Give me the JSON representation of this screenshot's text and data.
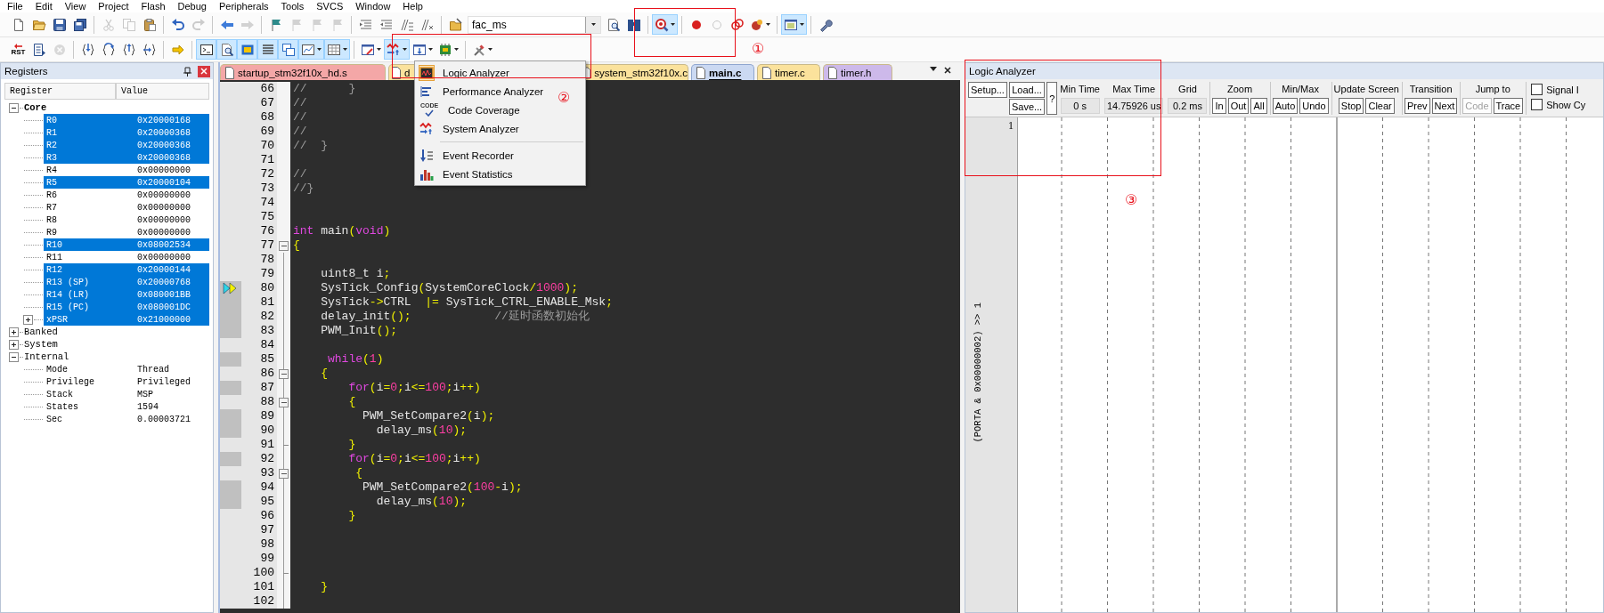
{
  "menu_bar": [
    "File",
    "Edit",
    "View",
    "Project",
    "Flash",
    "Debug",
    "Peripherals",
    "Tools",
    "SVCS",
    "Window",
    "Help"
  ],
  "toolbar_top": [
    {
      "kind": "new",
      "on": false,
      "disabled": false
    },
    {
      "kind": "open",
      "on": false,
      "disabled": false
    },
    {
      "kind": "save",
      "on": false,
      "disabled": false
    },
    {
      "kind": "saveall",
      "on": false,
      "disabled": false
    },
    {
      "kind": "separator"
    },
    {
      "kind": "cut",
      "on": false,
      "disabled": true
    },
    {
      "kind": "copy",
      "on": false,
      "disabled": true
    },
    {
      "kind": "paste",
      "on": false,
      "disabled": false
    },
    {
      "kind": "separator"
    },
    {
      "kind": "undo",
      "on": false,
      "disabled": false
    },
    {
      "kind": "redo",
      "on": false,
      "disabled": true
    },
    {
      "kind": "separator"
    },
    {
      "kind": "back",
      "on": false,
      "disabled": false
    },
    {
      "kind": "forward",
      "on": false,
      "disabled": true
    },
    {
      "kind": "separator"
    },
    {
      "kind": "bookmark",
      "on": false,
      "disabled": false
    },
    {
      "kind": "bookmarkprev",
      "on": false,
      "disabled": true
    },
    {
      "kind": "bookmarknext",
      "on": false,
      "disabled": true
    },
    {
      "kind": "bookmarkclear",
      "on": false,
      "disabled": true
    },
    {
      "kind": "separator"
    },
    {
      "kind": "indent",
      "on": false,
      "disabled": false
    },
    {
      "kind": "unindent",
      "on": false,
      "disabled": false
    },
    {
      "kind": "comment",
      "on": false,
      "disabled": false
    },
    {
      "kind": "uncomment",
      "on": false,
      "disabled": false
    },
    {
      "kind": "separator"
    },
    {
      "kind": "openfolder",
      "on": false,
      "disabled": false
    },
    {
      "kind": "search",
      "value": "fac_ms"
    },
    {
      "kind": "findfiles",
      "on": false,
      "disabled": false
    },
    {
      "kind": "incremental",
      "on": false,
      "disabled": false
    },
    {
      "kind": "separator"
    },
    {
      "kind": "debug",
      "on": true,
      "disabled": false,
      "caret": true
    },
    {
      "kind": "separator"
    },
    {
      "kind": "breakpoint",
      "on": false,
      "disabled": false
    },
    {
      "kind": "breakpointoff",
      "on": false,
      "disabled": false
    },
    {
      "kind": "disable",
      "on": false,
      "disabled": false
    },
    {
      "kind": "killall",
      "on": false,
      "disabled": false,
      "caret": true
    },
    {
      "kind": "separator"
    },
    {
      "kind": "window",
      "on": true,
      "disabled": false,
      "caret": true
    },
    {
      "kind": "separator"
    },
    {
      "kind": "configure",
      "on": false,
      "disabled": false
    }
  ],
  "toolbar_debug": [
    {
      "kind": "reset",
      "text": "RST",
      "on": false,
      "disabled": false
    },
    {
      "kind": "run",
      "on": false,
      "disabled": false
    },
    {
      "kind": "stop",
      "on": false,
      "disabled": true
    },
    {
      "kind": "separator"
    },
    {
      "kind": "stepin",
      "on": false,
      "disabled": false
    },
    {
      "kind": "stepover",
      "on": false,
      "disabled": false
    },
    {
      "kind": "stepout",
      "on": false,
      "disabled": false
    },
    {
      "kind": "runcursor",
      "on": false,
      "disabled": false
    },
    {
      "kind": "separator"
    },
    {
      "kind": "showpc",
      "on": false,
      "disabled": false
    },
    {
      "kind": "separator"
    },
    {
      "kind": "command",
      "on": true,
      "disabled": false
    },
    {
      "kind": "disassembly",
      "on": true,
      "disabled": false
    },
    {
      "kind": "symbols",
      "on": true,
      "disabled": false
    },
    {
      "kind": "registers",
      "on": true,
      "disabled": false
    },
    {
      "kind": "callstack",
      "on": true,
      "disabled": false
    },
    {
      "kind": "watch",
      "on": true,
      "disabled": false,
      "caret": true
    },
    {
      "kind": "memory",
      "on": true,
      "disabled": false,
      "caret": true
    },
    {
      "kind": "separator"
    },
    {
      "kind": "serial",
      "on": false,
      "disabled": false,
      "caret": true
    },
    {
      "kind": "analysis",
      "on": true,
      "disabled": false,
      "caret": true
    },
    {
      "kind": "trace",
      "on": false,
      "disabled": false,
      "caret": true
    },
    {
      "kind": "peripherals",
      "on": false,
      "disabled": false,
      "caret": true
    },
    {
      "kind": "separator"
    },
    {
      "kind": "toolbox",
      "on": false,
      "disabled": false,
      "caret": true
    }
  ],
  "analysis_menu": {
    "groups": [
      [
        {
          "label": "Logic Analyzer",
          "kind": "logic",
          "selected": true
        },
        {
          "label": "Performance Analyzer",
          "kind": "performance",
          "selected": false
        },
        {
          "label": "Code Coverage",
          "kind": "coverage",
          "icon_text": "CODE",
          "selected": false
        },
        {
          "label": "System Analyzer",
          "kind": "system",
          "selected": false
        }
      ],
      [
        {
          "label": "Event Recorder",
          "kind": "recorder",
          "selected": false
        },
        {
          "label": "Event Statistics",
          "kind": "statistics",
          "selected": false
        }
      ]
    ]
  },
  "registers": {
    "title": "Registers",
    "columns": [
      "Register",
      "Value"
    ],
    "tree": [
      {
        "name": "Core",
        "expanded": true,
        "emphasized": true,
        "children": [
          {
            "name": "R0",
            "value": "0x20000168",
            "selected": true
          },
          {
            "name": "R1",
            "value": "0x20000368",
            "selected": true
          },
          {
            "name": "R2",
            "value": "0x20000368",
            "selected": true
          },
          {
            "name": "R3",
            "value": "0x20000368",
            "selected": true
          },
          {
            "name": "R4",
            "value": "0x00000000",
            "selected": false
          },
          {
            "name": "R5",
            "value": "0x20000104",
            "selected": true
          },
          {
            "name": "R6",
            "value": "0x00000000",
            "selected": false
          },
          {
            "name": "R7",
            "value": "0x00000000",
            "selected": false
          },
          {
            "name": "R8",
            "value": "0x00000000",
            "selected": false
          },
          {
            "name": "R9",
            "value": "0x00000000",
            "selected": false
          },
          {
            "name": "R10",
            "value": "0x08002534",
            "selected": true
          },
          {
            "name": "R11",
            "value": "0x00000000",
            "selected": false
          },
          {
            "name": "R12",
            "value": "0x20000144",
            "selected": true
          },
          {
            "name": "R13 (SP)",
            "value": "0x20000768",
            "selected": true
          },
          {
            "name": "R14 (LR)",
            "value": "0x080001BB",
            "selected": true
          },
          {
            "name": "R15 (PC)",
            "value": "0x080001DC",
            "selected": true
          },
          {
            "name": "xPSR",
            "value": "0x21000000",
            "selected": true,
            "expanded": false
          }
        ]
      },
      {
        "name": "Banked",
        "expanded": false,
        "emphasized": false
      },
      {
        "name": "System",
        "expanded": false,
        "emphasized": false
      },
      {
        "name": "Internal",
        "expanded": true,
        "emphasized": false,
        "children": [
          {
            "name": "Mode",
            "value": "Thread",
            "selected": false
          },
          {
            "name": "Privilege",
            "value": "Privileged",
            "selected": false
          },
          {
            "name": "Stack",
            "value": "MSP",
            "selected": false
          },
          {
            "name": "States",
            "value": "1594",
            "selected": false
          },
          {
            "name": "Sec",
            "value": "0.00003721",
            "selected": false
          }
        ]
      }
    ]
  },
  "editor": {
    "tabs": [
      {
        "label": "startup_stm32f10x_hd.s",
        "color": "#f4a7a7",
        "selected": false
      },
      {
        "label": "d",
        "color": "#fbe29c",
        "selected": false
      },
      {
        "label": "system_stm32f10x.c",
        "color": "#fbe29c",
        "selected": false
      },
      {
        "label": "main.c",
        "color": "#cbd9f2",
        "selected": true
      },
      {
        "label": "timer.c",
        "color": "#fbe29c",
        "selected": false
      },
      {
        "label": "timer.h",
        "color": "#cdb9ea",
        "selected": false
      }
    ],
    "lines": [
      {
        "number": "66",
        "executable": false,
        "current": false,
        "fold_start": false,
        "fold_end": false,
        "segments": [
          {
            "kind": "comment",
            "text": "//      }"
          }
        ]
      },
      {
        "number": "67",
        "executable": false,
        "current": false,
        "fold_start": false,
        "fold_end": false,
        "segments": [
          {
            "kind": "comment",
            "text": "//"
          }
        ]
      },
      {
        "number": "68",
        "executable": false,
        "current": false,
        "fold_start": false,
        "fold_end": false,
        "segments": [
          {
            "kind": "comment",
            "text": "//"
          }
        ]
      },
      {
        "number": "69",
        "executable": false,
        "current": false,
        "fold_start": false,
        "fold_end": false,
        "segments": [
          {
            "kind": "comment",
            "text": "//"
          }
        ]
      },
      {
        "number": "70",
        "executable": false,
        "current": false,
        "fold_start": false,
        "fold_end": false,
        "segments": [
          {
            "kind": "comment",
            "text": "//  }"
          }
        ]
      },
      {
        "number": "71",
        "executable": false,
        "current": false,
        "fold_start": false,
        "fold_end": false
      },
      {
        "number": "72",
        "executable": false,
        "current": false,
        "fold_start": false,
        "fold_end": false,
        "segments": [
          {
            "kind": "comment",
            "text": "//"
          }
        ]
      },
      {
        "number": "73",
        "executable": false,
        "current": false,
        "fold_start": false,
        "fold_end": false,
        "segments": [
          {
            "kind": "comment",
            "text": "//}"
          }
        ]
      },
      {
        "number": "74",
        "executable": false,
        "current": false,
        "fold_start": false,
        "fold_end": false
      },
      {
        "number": "75",
        "executable": false,
        "current": false,
        "fold_start": false,
        "fold_end": false
      },
      {
        "number": "76",
        "executable": false,
        "current": false,
        "fold_start": false,
        "fold_end": false,
        "segments": [
          {
            "kind": "keyword",
            "text": "int"
          },
          {
            "kind": "code",
            "text": " main("
          },
          {
            "kind": "keyword",
            "text": "void"
          },
          {
            "kind": "code",
            "text": ")"
          }
        ]
      },
      {
        "number": "77",
        "executable": false,
        "current": false,
        "fold_start": true,
        "fold_end": false,
        "segments": [
          {
            "kind": "code",
            "text": "{"
          }
        ]
      },
      {
        "number": "78",
        "executable": false,
        "current": false,
        "fold_start": false,
        "fold_end": false
      },
      {
        "number": "79",
        "executable": false,
        "current": false,
        "fold_start": false,
        "fold_end": false,
        "segments": [
          {
            "kind": "code",
            "text": "    uint8_t i;"
          }
        ]
      },
      {
        "number": "80",
        "executable": true,
        "current": true,
        "fold_start": false,
        "fold_end": false,
        "segments": [
          {
            "kind": "code",
            "text": "    SysTick_Config(SystemCoreClock/1000);"
          }
        ]
      },
      {
        "number": "81",
        "executable": true,
        "current": false,
        "fold_start": false,
        "fold_end": false,
        "segments": [
          {
            "kind": "code",
            "text": "    SysTick->CTRL  |= SysTick_CTRL_ENABLE_Msk;"
          }
        ]
      },
      {
        "number": "82",
        "executable": true,
        "current": false,
        "fold_start": false,
        "fold_end": false,
        "segments": [
          {
            "kind": "code",
            "text": "    delay_init();            "
          },
          {
            "kind": "comment",
            "text": "//延时函数初始化"
          }
        ]
      },
      {
        "number": "83",
        "executable": true,
        "current": false,
        "fold_start": false,
        "fold_end": false,
        "segments": [
          {
            "kind": "code",
            "text": "    PWM_Init();"
          }
        ]
      },
      {
        "number": "84",
        "executable": false,
        "current": false,
        "fold_start": false,
        "fold_end": false
      },
      {
        "number": "85",
        "executable": true,
        "current": false,
        "fold_start": false,
        "fold_end": false,
        "segments": [
          {
            "kind": "keyword",
            "text": "     while"
          },
          {
            "kind": "code",
            "text": "(1)"
          }
        ]
      },
      {
        "number": "86",
        "executable": false,
        "current": false,
        "fold_start": true,
        "fold_end": false,
        "segments": [
          {
            "kind": "code",
            "text": "    {"
          }
        ]
      },
      {
        "number": "87",
        "executable": true,
        "current": false,
        "fold_start": false,
        "fold_end": false,
        "segments": [
          {
            "kind": "keyword",
            "text": "        for"
          },
          {
            "kind": "code",
            "text": "(i=0;i<=100;i++)"
          }
        ]
      },
      {
        "number": "88",
        "executable": false,
        "current": false,
        "fold_start": true,
        "fold_end": false,
        "segments": [
          {
            "kind": "code",
            "text": "        {"
          }
        ]
      },
      {
        "number": "89",
        "executable": true,
        "current": false,
        "fold_start": false,
        "fold_end": false,
        "segments": [
          {
            "kind": "code",
            "text": "          PWM_SetCompare2(i);"
          }
        ]
      },
      {
        "number": "90",
        "executable": true,
        "current": false,
        "fold_start": false,
        "fold_end": false,
        "segments": [
          {
            "kind": "code",
            "text": "            delay_ms(10);"
          }
        ]
      },
      {
        "number": "91",
        "executable": false,
        "current": false,
        "fold_start": false,
        "fold_end": true,
        "segments": [
          {
            "kind": "code",
            "text": "        }"
          }
        ]
      },
      {
        "number": "92",
        "executable": true,
        "current": false,
        "fold_start": false,
        "fold_end": false,
        "segments": [
          {
            "kind": "keyword",
            "text": "        for"
          },
          {
            "kind": "code",
            "text": "(i=0;i<=100;i++)"
          }
        ]
      },
      {
        "number": "93",
        "executable": false,
        "current": false,
        "fold_start": true,
        "fold_end": false,
        "segments": [
          {
            "kind": "code",
            "text": "         {"
          }
        ]
      },
      {
        "number": "94",
        "executable": true,
        "current": false,
        "fold_start": false,
        "fold_end": false,
        "segments": [
          {
            "kind": "code",
            "text": "          PWM_SetCompare2(100-i);"
          }
        ]
      },
      {
        "number": "95",
        "executable": true,
        "current": false,
        "fold_start": false,
        "fold_end": false,
        "segments": [
          {
            "kind": "code",
            "text": "            delay_ms(10);"
          }
        ]
      },
      {
        "number": "96",
        "executable": false,
        "current": false,
        "fold_start": false,
        "fold_end": false,
        "segments": [
          {
            "kind": "code",
            "text": "        }"
          }
        ]
      },
      {
        "number": "97",
        "executable": false,
        "current": false,
        "fold_start": false,
        "fold_end": false
      },
      {
        "number": "98",
        "executable": false,
        "current": false,
        "fold_start": false,
        "fold_end": false
      },
      {
        "number": "99",
        "executable": false,
        "current": false,
        "fold_start": false,
        "fold_end": false
      },
      {
        "number": "100",
        "executable": false,
        "current": false,
        "fold_start": false,
        "fold_end": true
      },
      {
        "number": "101",
        "executable": false,
        "current": false,
        "fold_start": false,
        "fold_end": false,
        "segments": [
          {
            "kind": "code",
            "text": "    }"
          }
        ]
      },
      {
        "number": "102",
        "executable": false,
        "current": false,
        "fold_start": false,
        "fold_end": false
      }
    ]
  },
  "logic_analyzer": {
    "title": "Logic Analyzer",
    "file_buttons": [
      "Setup...",
      "Load...",
      "Save..."
    ],
    "help_button": "?",
    "readouts": [
      {
        "label": "Min Time",
        "value": "0 s"
      },
      {
        "label": "Max Time",
        "value": "14.75926 us"
      },
      {
        "label": "Grid",
        "value": "0.2 ms"
      }
    ],
    "groups": [
      {
        "label": "Zoom",
        "buttons": [
          {
            "label": "In",
            "disabled": false
          },
          {
            "label": "Out",
            "disabled": false
          },
          {
            "label": "All",
            "disabled": false
          }
        ]
      },
      {
        "label": "Min/Max",
        "buttons": [
          {
            "label": "Auto",
            "disabled": false
          },
          {
            "label": "Undo",
            "disabled": false
          }
        ]
      },
      {
        "label": "Update Screen",
        "buttons": [
          {
            "label": "Stop",
            "disabled": false
          },
          {
            "label": "Clear",
            "disabled": false
          }
        ]
      },
      {
        "label": "Transition",
        "buttons": [
          {
            "label": "Prev",
            "disabled": false
          },
          {
            "label": "Next",
            "disabled": false
          }
        ]
      },
      {
        "label": "Jump to",
        "buttons": [
          {
            "label": "Code",
            "disabled": true
          },
          {
            "label": "Trace",
            "disabled": false
          }
        ]
      }
    ],
    "options": [
      {
        "label": "Signal I",
        "checked": false
      },
      {
        "label": "Show Cy",
        "checked": false
      }
    ],
    "signals": [
      {
        "value": "1",
        "name": "(PORTA & 0x00000002) >> 1"
      }
    ]
  },
  "annotations": [
    {
      "label": "①"
    },
    {
      "label": "②"
    },
    {
      "label": "③"
    }
  ]
}
